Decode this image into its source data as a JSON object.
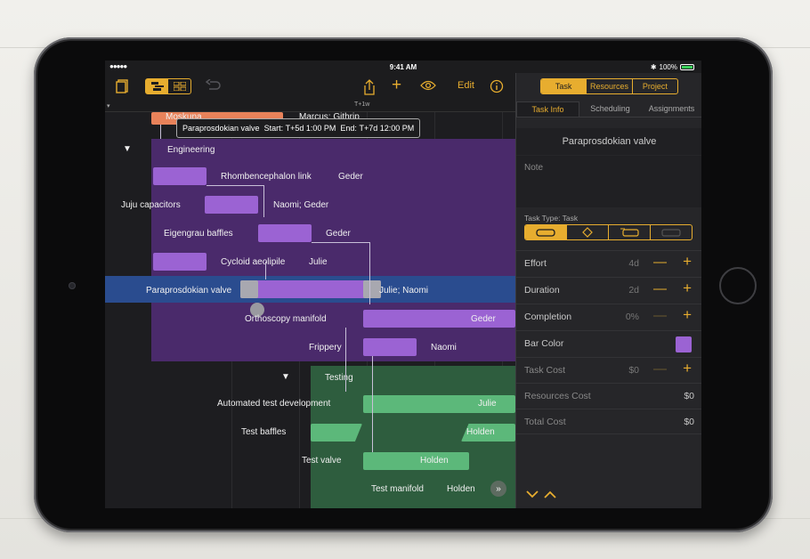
{
  "status": {
    "signal": "●●●●● ",
    "time": "9:41 AM",
    "bluetooth": "✱",
    "battery": "100%"
  },
  "toolbar": {
    "edit": "Edit"
  },
  "ruler": {
    "mark": "T+1w"
  },
  "tooltip": {
    "task": "Paraprosdokian valve",
    "start_label": "Start:",
    "start": "T+5d 1:00 PM",
    "end_label": "End:",
    "end": "T+7d 12:00 PM"
  },
  "gantt": {
    "top_partial": {
      "task": "Moskuna",
      "resource": "Marcus; Githrip"
    },
    "engineering": "Engineering",
    "tasks": [
      {
        "name": "Rhombencephalon link",
        "resource": "Geder"
      },
      {
        "name": "Juju capacitors",
        "resource": "Naomi; Geder"
      },
      {
        "name": "Eigengrau baffles",
        "resource": "Geder"
      },
      {
        "name": "Cycloid aeolipile",
        "resource": "Julie"
      },
      {
        "name": "Paraprosdokian valve",
        "resource": "Julie; Naomi"
      },
      {
        "name": "Orthoscopy manifold",
        "resource": "Geder"
      },
      {
        "name": "Frippery",
        "resource": "Naomi"
      }
    ],
    "testing": "Testing",
    "test_tasks": [
      {
        "name": "Automated test development",
        "resource": "Julie"
      },
      {
        "name": "Test baffles",
        "resource": "Holden"
      },
      {
        "name": "Test valve",
        "resource": "Holden"
      },
      {
        "name": "Test manifold",
        "resource": "Holden"
      }
    ]
  },
  "inspector": {
    "segments": [
      "Task",
      "Resources",
      "Project"
    ],
    "tabs": [
      "Task Info",
      "Scheduling",
      "Assignments"
    ],
    "title": "Paraprosdokian valve",
    "note_placeholder": "Note",
    "task_type": "Task Type: Task",
    "rows": [
      {
        "label": "Effort",
        "value": "4d"
      },
      {
        "label": "Duration",
        "value": "2d"
      },
      {
        "label": "Completion",
        "value": "0%"
      }
    ],
    "bar_color_label": "Bar Color",
    "task_cost": {
      "label": "Task Cost",
      "value": "$0"
    },
    "resources_cost": {
      "label": "Resources Cost",
      "value": "$0"
    },
    "total_cost": {
      "label": "Total Cost",
      "value": "$0"
    }
  },
  "colors": {
    "accent": "#e7ad2f",
    "engineering_group": "#4a2a6b",
    "task_bar": "#9b63d3",
    "selected_row": "#2a4c8f",
    "testing_group": "#2e5d3e",
    "test_bar": "#5cb87a",
    "milestone_orange": "#e8825a"
  }
}
